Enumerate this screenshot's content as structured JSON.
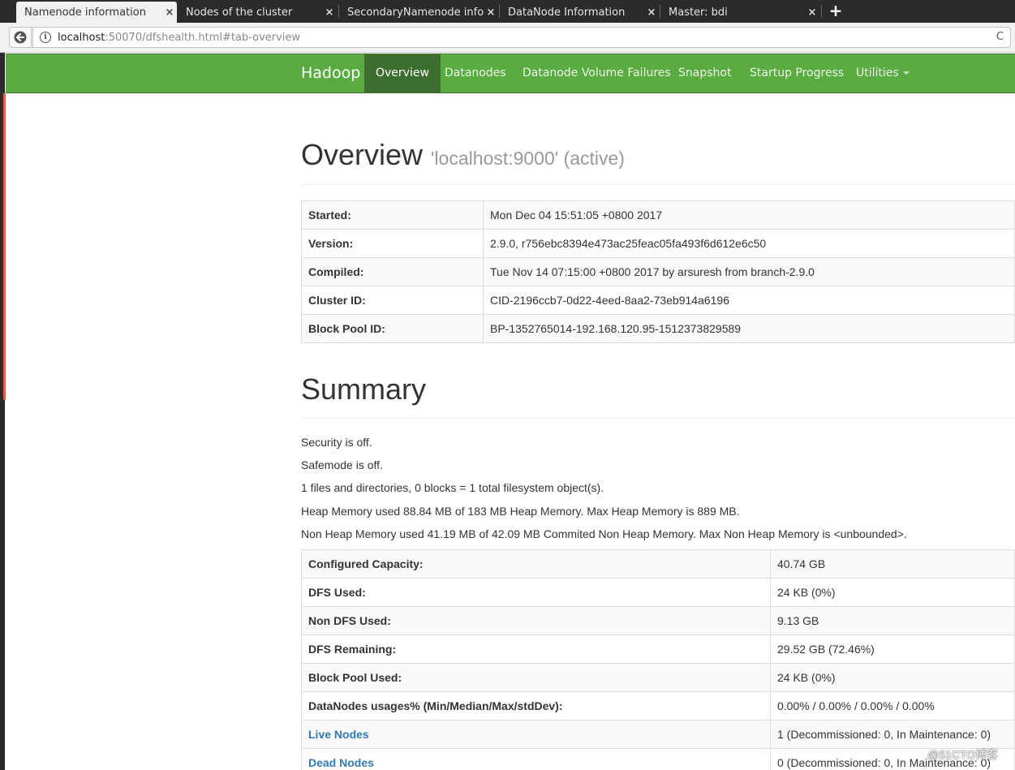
{
  "browser": {
    "tabs": [
      {
        "label": "Namenode information",
        "active": true
      },
      {
        "label": "Nodes of the cluster",
        "active": false
      },
      {
        "label": "SecondaryNamenode inform",
        "active": false
      },
      {
        "label": "DataNode Information",
        "active": false
      },
      {
        "label": "Master: bdi",
        "active": false
      }
    ],
    "close_glyph": "×",
    "new_tab_glyph": "+",
    "url_host": "localhost",
    "url_rest": ":50070/dfshealth.html#tab-overview",
    "info_glyph": "i",
    "reload_glyph": "C"
  },
  "navbar": {
    "brand": "Hadoop",
    "items": [
      {
        "label": "Overview",
        "active": true
      },
      {
        "label": "Datanodes"
      },
      {
        "label": "Datanode Volume Failures"
      },
      {
        "label": "Snapshot"
      },
      {
        "label": "Startup Progress"
      },
      {
        "label": "Utilities"
      }
    ],
    "accent_color": "#5aab42",
    "active_color": "#3d6e30"
  },
  "overview": {
    "title": "Overview",
    "subtitle": "'localhost:9000' (active)",
    "rows": [
      {
        "key": "Started:",
        "value": "Mon Dec 04 15:51:05 +0800 2017"
      },
      {
        "key": "Version:",
        "value": "2.9.0, r756ebc8394e473ac25feac05fa493f6d612e6c50"
      },
      {
        "key": "Compiled:",
        "value": "Tue Nov 14 07:15:00 +0800 2017 by arsuresh from branch-2.9.0"
      },
      {
        "key": "Cluster ID:",
        "value": "CID-2196ccb7-0d22-4eed-8aa2-73eb914a6196"
      },
      {
        "key": "Block Pool ID:",
        "value": "BP-1352765014-192.168.120.95-1512373829589"
      }
    ]
  },
  "summary": {
    "title": "Summary",
    "lines": [
      "Security is off.",
      "Safemode is off.",
      "1 files and directories, 0 blocks = 1 total filesystem object(s).",
      "Heap Memory used 88.84 MB of 183 MB Heap Memory. Max Heap Memory is 889 MB.",
      "Non Heap Memory used 41.19 MB of 42.09 MB Commited Non Heap Memory. Max Non Heap Memory is <unbounded>."
    ],
    "rows": [
      {
        "key": "Configured Capacity:",
        "value": "40.74 GB"
      },
      {
        "key": "DFS Used:",
        "value": "24 KB (0%)"
      },
      {
        "key": "Non DFS Used:",
        "value": "9.13 GB"
      },
      {
        "key": "DFS Remaining:",
        "value": "29.52 GB (72.46%)"
      },
      {
        "key": "Block Pool Used:",
        "value": "24 KB (0%)"
      },
      {
        "key": "DataNodes usages% (Min/Median/Max/stdDev):",
        "value": "0.00% / 0.00% / 0.00% / 0.00%"
      },
      {
        "key": "Live Nodes",
        "value": "1 (Decommissioned: 0, In Maintenance: 0)",
        "link": true
      },
      {
        "key": "Dead Nodes",
        "value": "0 (Decommissioned: 0, In Maintenance: 0)",
        "link": true
      }
    ]
  },
  "watermark": "@51CTO博客"
}
